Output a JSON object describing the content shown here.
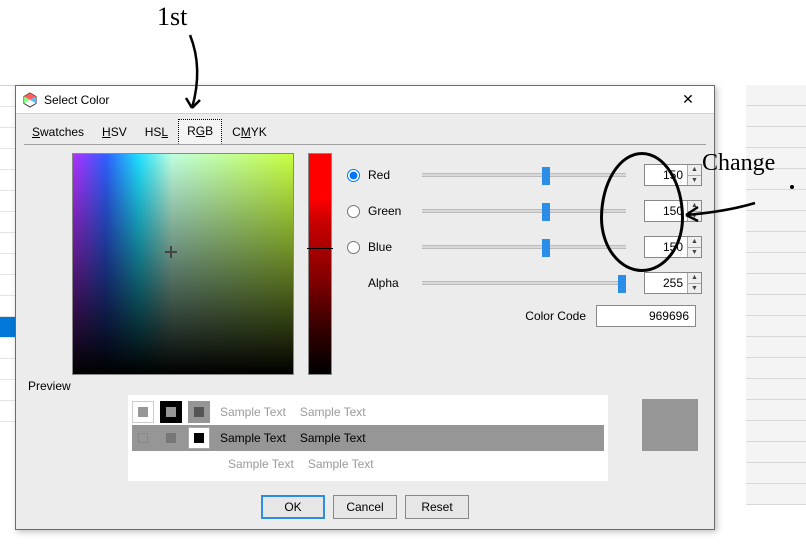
{
  "annotations": {
    "first": "1st",
    "change": "Change"
  },
  "dialog": {
    "title": "Select Color",
    "close_glyph": "✕",
    "tabs": {
      "swatches": "Swatches",
      "hsv": "HSV",
      "hsl": "HSL",
      "rgb": "RGB",
      "cmyk": "CMYK",
      "swatches_u": "S",
      "hsv_u": "H",
      "hsl_u": "L",
      "rgb_u": "G",
      "cmyk_u": "M"
    },
    "channels": {
      "red": {
        "label": "Red",
        "value": "150",
        "slider_pct": 59
      },
      "green": {
        "label": "Green",
        "value": "150",
        "slider_pct": 59
      },
      "blue": {
        "label": "Blue",
        "value": "150",
        "slider_pct": 59
      },
      "alpha": {
        "label": "Alpha",
        "value": "255",
        "slider_pct": 100
      }
    },
    "colorcode_label": "Color Code",
    "colorcode_value": "969696",
    "preview_label": "Preview",
    "sample_text": "Sample Text",
    "preview_color": "#969696",
    "buttons": {
      "ok": "OK",
      "cancel": "Cancel",
      "reset": "Reset"
    }
  }
}
